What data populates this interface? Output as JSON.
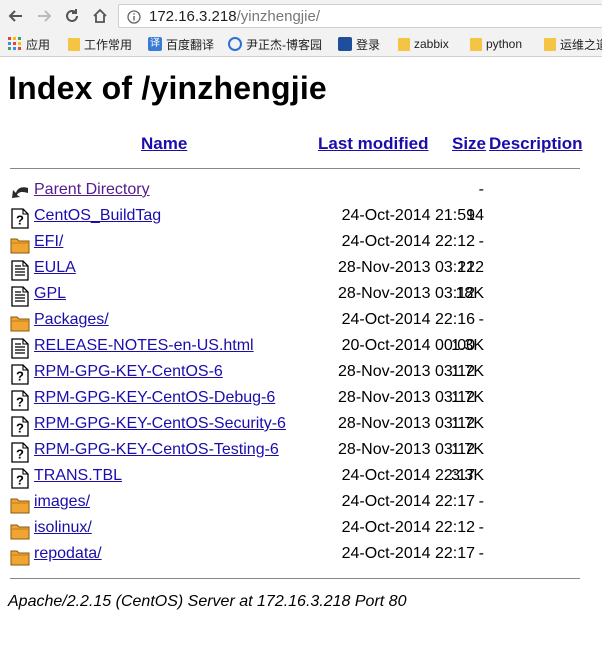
{
  "browser": {
    "url_host": "172.16.3.218",
    "url_path": "/yinzhengjie/",
    "bookmarks": [
      {
        "label": "应用",
        "icon": "apps-grid-icon"
      },
      {
        "label": "工作常用",
        "icon": "folder-icon"
      },
      {
        "label": "百度翻译",
        "icon": "translate-icon"
      },
      {
        "label": "尹正杰-博客园",
        "icon": "blog-icon"
      },
      {
        "label": "登录",
        "icon": "login-icon"
      },
      {
        "label": "zabbix",
        "icon": "folder-icon"
      },
      {
        "label": "python",
        "icon": "folder-icon"
      },
      {
        "label": "运维之道",
        "icon": "folder-icon"
      }
    ]
  },
  "page": {
    "title": "Index of /yinzhengjie",
    "columns": {
      "name": "Name",
      "last_modified": "Last modified",
      "size": "Size",
      "description": "Description"
    },
    "rows": [
      {
        "name": "Parent Directory",
        "date": "",
        "size": "-",
        "icon": "back-arrow-icon"
      },
      {
        "name": "CentOS_BuildTag",
        "date": "24-Oct-2014 21:59",
        "size": "14",
        "icon": "unknown-file-icon"
      },
      {
        "name": "EFI/",
        "date": "24-Oct-2014 22:12",
        "size": "-",
        "icon": "folder-icon"
      },
      {
        "name": "EULA",
        "date": "28-Nov-2013 03:12",
        "size": "212",
        "icon": "text-file-icon"
      },
      {
        "name": "GPL",
        "date": "28-Nov-2013 03:12",
        "size": "18K",
        "icon": "text-file-icon"
      },
      {
        "name": "Packages/",
        "date": "24-Oct-2014 22:16",
        "size": "-",
        "icon": "folder-icon"
      },
      {
        "name": "RELEASE-NOTES-en-US.html",
        "date": "20-Oct-2014 00:00",
        "size": "1.3K",
        "icon": "text-file-icon"
      },
      {
        "name": "RPM-GPG-KEY-CentOS-6",
        "date": "28-Nov-2013 03:12",
        "size": "1.7K",
        "icon": "unknown-file-icon"
      },
      {
        "name": "RPM-GPG-KEY-CentOS-Debug-6",
        "date": "28-Nov-2013 03:12",
        "size": "1.7K",
        "icon": "unknown-file-icon"
      },
      {
        "name": "RPM-GPG-KEY-CentOS-Security-6",
        "date": "28-Nov-2013 03:12",
        "size": "1.7K",
        "icon": "unknown-file-icon"
      },
      {
        "name": "RPM-GPG-KEY-CentOS-Testing-6",
        "date": "28-Nov-2013 03:12",
        "size": "1.7K",
        "icon": "unknown-file-icon"
      },
      {
        "name": "TRANS.TBL",
        "date": "24-Oct-2014 22:17",
        "size": "3.3K",
        "icon": "unknown-file-icon"
      },
      {
        "name": "images/",
        "date": "24-Oct-2014 22:17",
        "size": "-",
        "icon": "folder-icon"
      },
      {
        "name": "isolinux/",
        "date": "24-Oct-2014 22:12",
        "size": "-",
        "icon": "folder-icon"
      },
      {
        "name": "repodata/",
        "date": "24-Oct-2014 22:17",
        "size": "-",
        "icon": "folder-icon"
      }
    ],
    "footer": "Apache/2.2.15 (CentOS) Server at 172.16.3.218 Port 80"
  }
}
